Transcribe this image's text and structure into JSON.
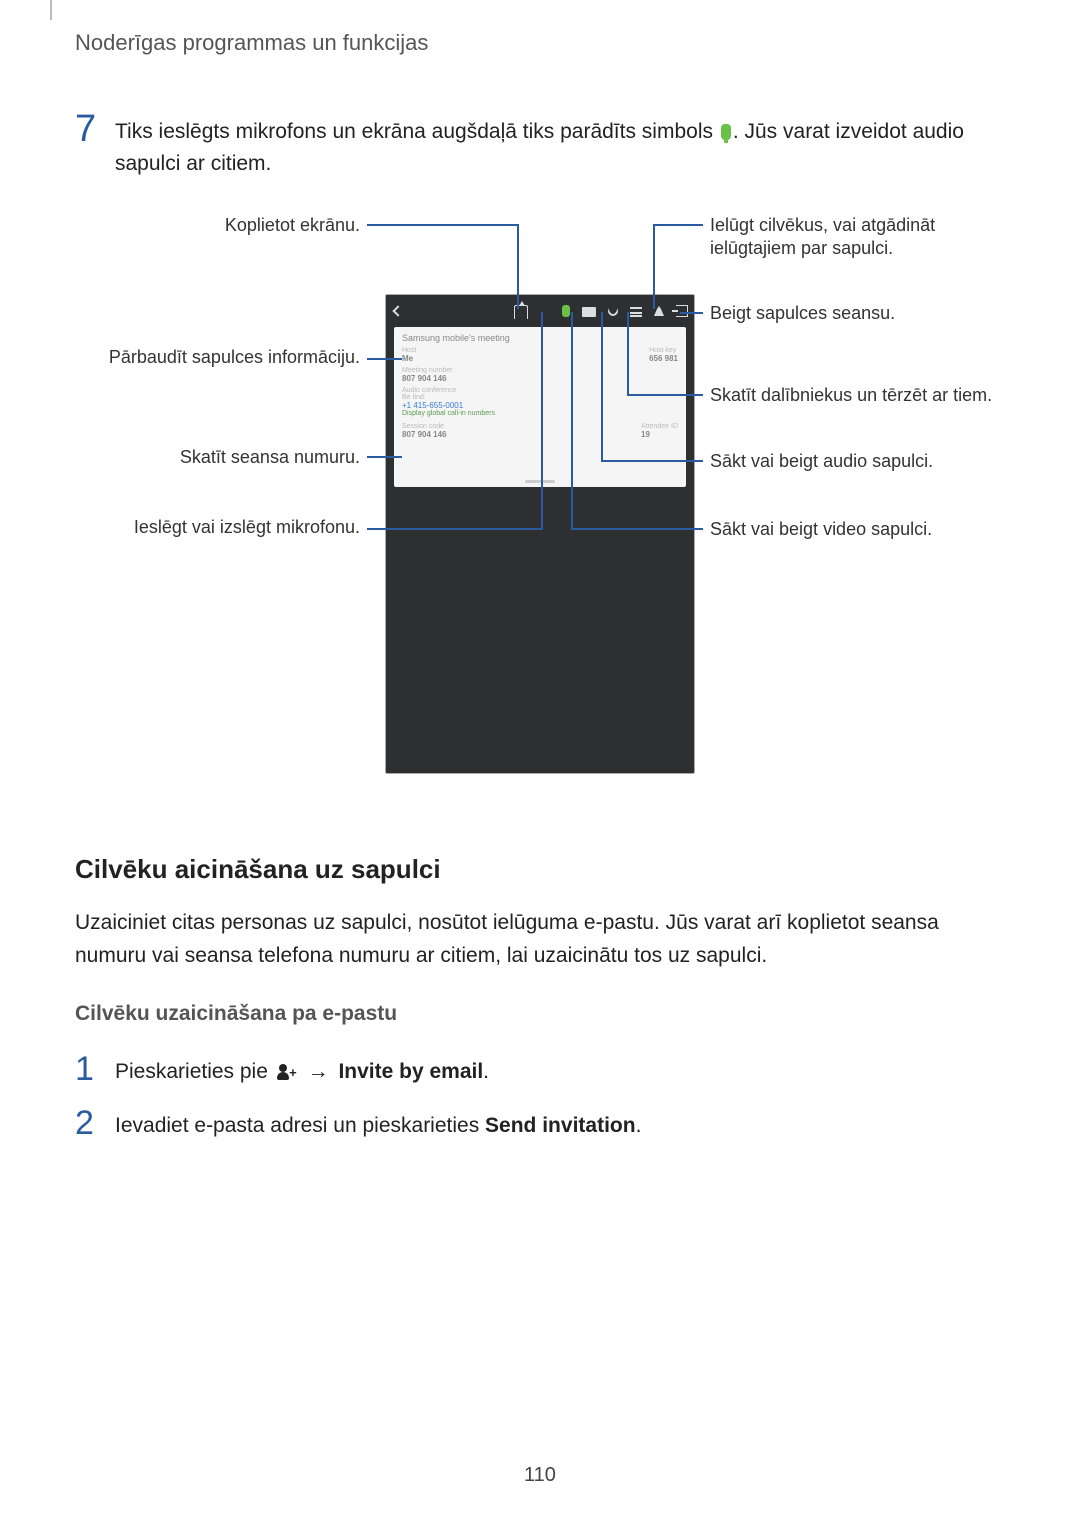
{
  "header": {
    "section_title": "Noderīgas programmas un funkcijas"
  },
  "step7": {
    "number": "7",
    "text_before": "Tiks ieslēgts mikrofons un ekrāna augšdaļā tiks parādīts simbols ",
    "text_after": ". Jūs varat izveidot audio sapulci ar citiem."
  },
  "callouts": {
    "left": {
      "share_screen": "Koplietot ekrānu.",
      "check_info": "Pārbaudīt sapulces informāciju.",
      "session_number": "Skatīt seansa numuru.",
      "mic_toggle": "Ieslēgt vai izslēgt mikrofonu."
    },
    "right": {
      "invite": "Ielūgt cilvēkus, vai atgādināt ielūgtajiem par sapulci.",
      "end_session": "Beigt sapulces seansu.",
      "participants": "Skatīt dalībniekus un tērzēt ar tiem.",
      "audio": "Sākt vai beigt audio sapulci.",
      "video": "Sākt vai beigt video sapulci."
    }
  },
  "device_card": {
    "meeting_title": "Samsung mobile's meeting",
    "host_lbl": "Host",
    "host_val": "Me",
    "hostkey_lbl": "Host key",
    "hostkey_val": "656 981",
    "mnum_lbl": "Meeting number",
    "mnum_val": "807 904 146",
    "aconf_lbl": "Audio conference",
    "aconf_val": "Be find:",
    "phone": "+1 415-655-0001",
    "global_link": "Display global call-in numbers",
    "sess_lbl": "Session code",
    "sess_val": "807 904 146",
    "att_lbl": "Attendee ID",
    "att_val": "19"
  },
  "section": {
    "h2": "Cilvēku aicināšana uz sapulci",
    "p": "Uzaiciniet citas personas uz sapulci, nosūtot ielūguma e-pastu. Jūs varat arī koplietot seansa numuru vai seansa telefona numuru ar citiem, lai uzaicinātu tos uz sapulci.",
    "h3": "Cilvēku uzaicināšana pa e-pastu",
    "steps": [
      {
        "num": "1",
        "before": "Pieskarieties pie ",
        "arrow": "→",
        "bold": "Invite by email",
        "after": "."
      },
      {
        "num": "2",
        "before": "Ievadiet e-pasta adresi un pieskarieties ",
        "bold": "Send invitation",
        "after": "."
      }
    ]
  },
  "page_number": "110"
}
